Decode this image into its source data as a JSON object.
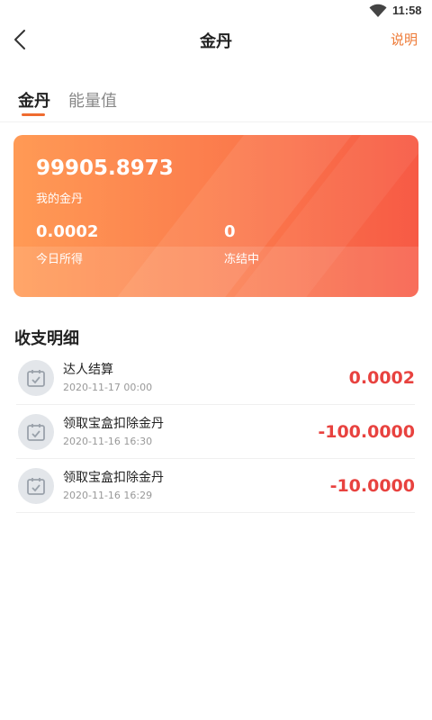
{
  "status_bar": {
    "time": "11:58"
  },
  "nav": {
    "title": "金丹",
    "action_label": "说明"
  },
  "tabs": [
    {
      "label": "金丹",
      "active": true
    },
    {
      "label": "能量值",
      "active": false
    }
  ],
  "summary": {
    "total_value": "99905.8973",
    "total_label": "我的金丹",
    "today_value": "0.0002",
    "today_label": "今日所得",
    "frozen_value": "0",
    "frozen_label": "冻结中"
  },
  "transactions_title": "收支明细",
  "transactions": [
    {
      "title": "达人结算",
      "date": "2020-11-17 00:00",
      "amount": "0.0002"
    },
    {
      "title": "领取宝盒扣除金丹",
      "date": "2020-11-16 16:30",
      "amount": "-100.0000"
    },
    {
      "title": "领取宝盒扣除金丹",
      "date": "2020-11-16 16:29",
      "amount": "-10.0000"
    }
  ],
  "colors": {
    "accent": "#ee7a36",
    "amount_red": "#e8423f",
    "card_start": "#ff9a55",
    "card_end": "#f75a45"
  },
  "icons": {
    "back": "chevron-left-icon",
    "wifi": "wifi-icon",
    "transaction": "calendar-check-icon"
  }
}
